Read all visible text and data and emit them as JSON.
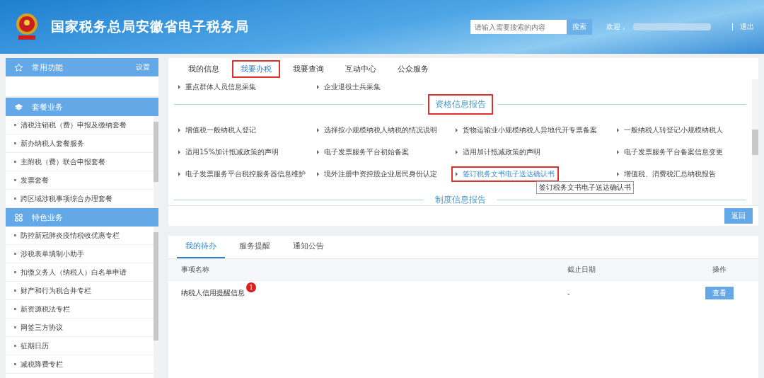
{
  "header": {
    "title": "国家税务总局安徽省电子税务局",
    "search": {
      "placeholder": "请输入需要搜索的内容",
      "button": "搜索"
    },
    "welcome": "欢迎，",
    "logout": "退出"
  },
  "sidebar": {
    "panels": [
      {
        "kind": "common",
        "title": "常用功能",
        "action": "设置"
      },
      {
        "kind": "list",
        "title": "套餐业务",
        "items": [
          "清税注销税（费）申报及缴纳套餐",
          "新办纳税人套餐服务",
          "主附税（费）联合申报套餐",
          "发票套餐",
          "跨区域涉税事项综合办理套餐"
        ]
      },
      {
        "kind": "list",
        "title": "特色业务",
        "items": [
          "防控新冠肺炎疫情税收优惠专栏",
          "涉税表单填制小助手",
          "扣缴义务人（纳税人）白名单申请",
          "财产和行为税合并专栏",
          "新资源税法专栏",
          "网签三方协议",
          "征期日历",
          "减税降费专栏"
        ]
      }
    ]
  },
  "main_tabs": [
    {
      "label": "我的信息",
      "selected": false,
      "highlighted": false
    },
    {
      "label": "我要办税",
      "selected": true,
      "highlighted": true
    },
    {
      "label": "我要查询",
      "selected": false,
      "highlighted": false
    },
    {
      "label": "互动中心",
      "selected": false,
      "highlighted": false
    },
    {
      "label": "公众服务",
      "selected": false,
      "highlighted": false
    }
  ],
  "services": {
    "leading_items": [
      "重点群体人员信息采集",
      "企业退役士兵采集"
    ],
    "sections": [
      {
        "title": "资格信息报告",
        "highlighted": true,
        "items": [
          {
            "label": "增值税一般纳税人登记",
            "highlighted": false
          },
          {
            "label": "选择按小规模纳税人纳税的情况说明",
            "highlighted": false
          },
          {
            "label": "货物运输业小规模纳税人异地代开专票备案",
            "highlighted": false
          },
          {
            "label": "一般纳税人转登记小规模纳税人",
            "highlighted": false
          },
          {
            "label": "适用15%加计抵减政策的声明",
            "highlighted": false
          },
          {
            "label": "电子发票服务平台初始备案",
            "highlighted": false
          },
          {
            "label": "适用加计抵减政策的声明",
            "highlighted": false
          },
          {
            "label": "电子发票服务平台备案信息变更",
            "highlighted": false
          },
          {
            "label": "电子发票服务平台税控服务器信息维护",
            "highlighted": false
          },
          {
            "label": "境外注册中资控股企业居民身份认定",
            "highlighted": false
          },
          {
            "label": "签订税务文书电子送达确认书",
            "highlighted": true,
            "tooltip": "签订税务文书电子送达确认书"
          },
          {
            "label": "增值税、消费税汇总纳税报告",
            "highlighted": false
          }
        ]
      },
      {
        "title": "制度信息报告",
        "highlighted": false
      }
    ],
    "back_button": "返回"
  },
  "todo": {
    "tabs": [
      {
        "label": "我的待办",
        "selected": true
      },
      {
        "label": "服务提醒",
        "selected": false
      },
      {
        "label": "通知公告",
        "selected": false
      }
    ],
    "columns": [
      "事项名称",
      "截止日期",
      "操作"
    ],
    "rows": [
      {
        "name": "纳税人信用提醒信息",
        "badge": "1",
        "deadline": "-",
        "action": "查看"
      }
    ]
  }
}
